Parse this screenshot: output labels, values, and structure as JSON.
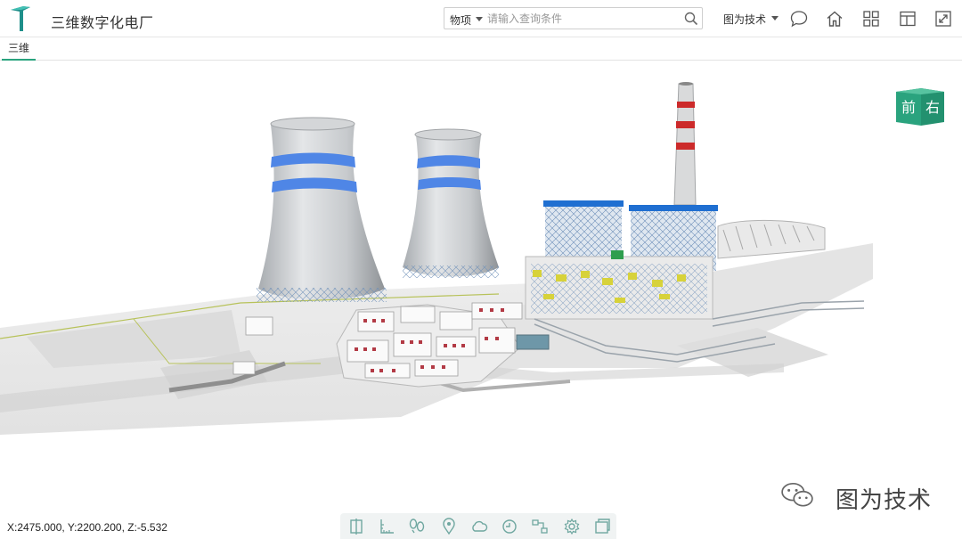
{
  "app": {
    "title": "三维数字化电厂",
    "logo": "logo-icon"
  },
  "search": {
    "category": "物项",
    "placeholder": "请输入查询条件",
    "value": ""
  },
  "user": {
    "name": "图为技术"
  },
  "header_icons": [
    "message-icon",
    "home-icon",
    "grid-icon",
    "layout-icon",
    "fullscreen-icon"
  ],
  "tabs": [
    {
      "label": "三维",
      "active": true
    }
  ],
  "view_cube": {
    "front": "前",
    "right": "右"
  },
  "status": {
    "coordinates": "X:2475.000, Y:2200.200, Z:-5.532"
  },
  "toolbar": {
    "tools": [
      "section-icon",
      "measure-icon",
      "walk-icon",
      "location-icon",
      "cloud-icon",
      "rotate-icon",
      "process-icon",
      "settings-icon",
      "window-icon"
    ]
  },
  "watermark": {
    "text": "图为技术",
    "icon": "wechat-icon"
  },
  "colors": {
    "accent": "#2aa37e",
    "stack_band": "#cc2a2a",
    "tower_band": "#4f86e6",
    "steel": "#1f6fd1"
  }
}
